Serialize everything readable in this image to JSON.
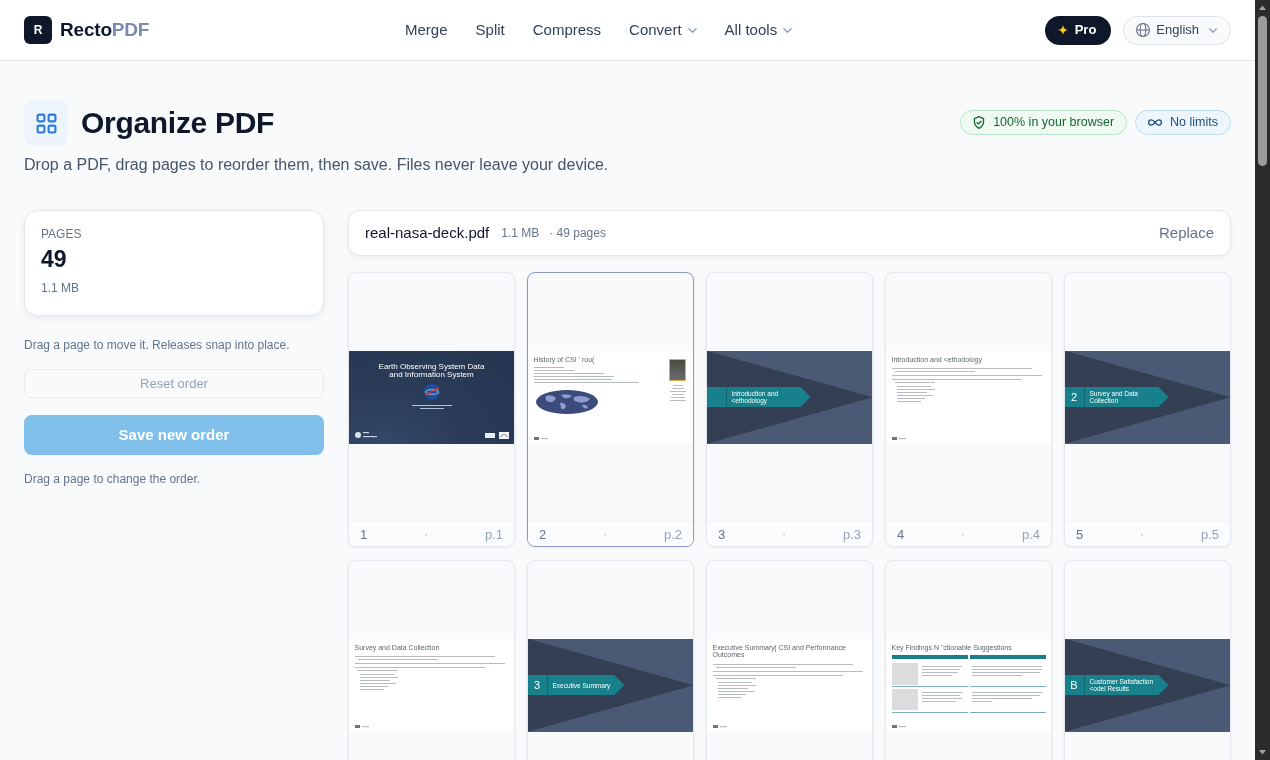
{
  "header": {
    "logo_mark": "R",
    "brand": "Recto",
    "brand_accent": "PDF",
    "nav": [
      {
        "label": "Merge",
        "dropdown": false
      },
      {
        "label": "Split",
        "dropdown": false
      },
      {
        "label": "Compress",
        "dropdown": false
      },
      {
        "label": "Convert",
        "dropdown": true
      },
      {
        "label": "All tools",
        "dropdown": true
      }
    ],
    "pro_label": "Pro",
    "language": "English"
  },
  "heading": {
    "title": "Organize PDF",
    "subtitle": "Drop a PDF, drag pages to reorder them, then save. Files never leave your device.",
    "badges": [
      {
        "label": "100% in your browser",
        "kind": "privacy"
      },
      {
        "label": "No limits",
        "kind": "unlimited"
      }
    ]
  },
  "summary": {
    "label": "PAGES",
    "count": "49",
    "size": "1.1 MB"
  },
  "move_hint": "Drag a page to move it. Releases snap into place.",
  "reset_button": {
    "label": "Reset order",
    "disabled": true
  },
  "save_button": {
    "label": "Save new order",
    "disabled": true
  },
  "order_hint": "Drag a page to change the order.",
  "file": {
    "name": "real-nasa-deck.pdf",
    "size": "1.1 MB",
    "pages": "· 49 pages",
    "action": "Replace"
  },
  "pages": [
    {
      "number": "1",
      "separator": "·",
      "label": "p.1",
      "selected": false,
      "slide": {
        "kind": "cover",
        "title": "Earth Observing System Data and Information System"
      }
    },
    {
      "number": "2",
      "separator": "·",
      "label": "p.2",
      "selected": true,
      "slide": {
        "kind": "text-map",
        "title": "History of CSI ' rou("
      }
    },
    {
      "number": "3",
      "separator": "·",
      "label": "p.3",
      "selected": false,
      "slide": {
        "kind": "section",
        "title": "Introduction and <ethodology"
      }
    },
    {
      "number": "4",
      "separator": "·",
      "label": "p.4",
      "selected": false,
      "slide": {
        "kind": "text",
        "title": "Introduction and <ethodology"
      }
    },
    {
      "number": "5",
      "separator": "·",
      "label": "p.5",
      "selected": false,
      "slide": {
        "kind": "section",
        "marker": "2",
        "title": "Survey and Data Collection"
      }
    },
    {
      "selected": false,
      "slide": {
        "kind": "text",
        "title": "Survey and Data Collection"
      }
    },
    {
      "selected": false,
      "slide": {
        "kind": "section",
        "marker": "3",
        "title": "Executive Summary"
      }
    },
    {
      "selected": false,
      "slide": {
        "kind": "text",
        "title": "Executive Summary| CSI and Performance Outcomes"
      }
    },
    {
      "selected": false,
      "slide": {
        "kind": "table",
        "title": "Key Findings N ˜ctionable Suggestions"
      }
    },
    {
      "selected": false,
      "slide": {
        "kind": "section",
        "marker": "B",
        "title": "Customer Satisfaction <odel Results"
      }
    }
  ]
}
